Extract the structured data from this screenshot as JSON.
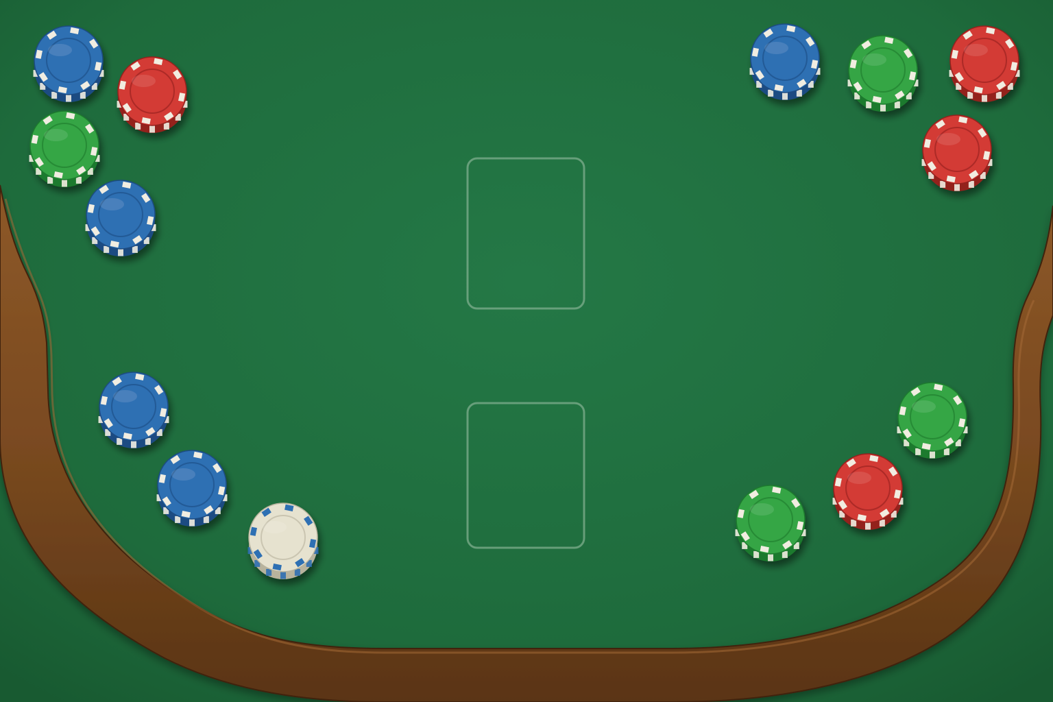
{
  "table": {
    "felt_color": "#1f6b3b",
    "felt_light": "#237443",
    "felt_dark": "#17562f",
    "rail_color": "#7a4a20",
    "rail_highlight": "#9a6030",
    "rail_shadow": "#4c2c10",
    "outside_felt": "#1a5e34"
  },
  "card_slots": [
    {
      "name": "card-slot-upper",
      "state": "empty"
    },
    {
      "name": "card-slot-lower",
      "state": "empty"
    }
  ],
  "chip_colors": {
    "blue": {
      "base": "#2f6fb3",
      "dark": "#1d4c82",
      "edge": "#f1ede1"
    },
    "red": {
      "base": "#d33a35",
      "dark": "#93201f",
      "edge": "#f1ede1"
    },
    "green": {
      "base": "#35a545",
      "dark": "#1f7a2d",
      "edge": "#f1ede1"
    },
    "white": {
      "base": "#e6e2cf",
      "dark": "#b8b39d",
      "edge": "#2f6fb3"
    }
  },
  "chip_groups": [
    {
      "name": "chips-top-left",
      "chips": [
        "blue",
        "red",
        "green",
        "blue"
      ]
    },
    {
      "name": "chips-top-right",
      "chips": [
        "blue",
        "green",
        "red",
        "red"
      ]
    },
    {
      "name": "chips-bottom-left",
      "chips": [
        "blue",
        "blue",
        "white"
      ]
    },
    {
      "name": "chips-bottom-right",
      "chips": [
        "green",
        "red",
        "green"
      ]
    }
  ]
}
